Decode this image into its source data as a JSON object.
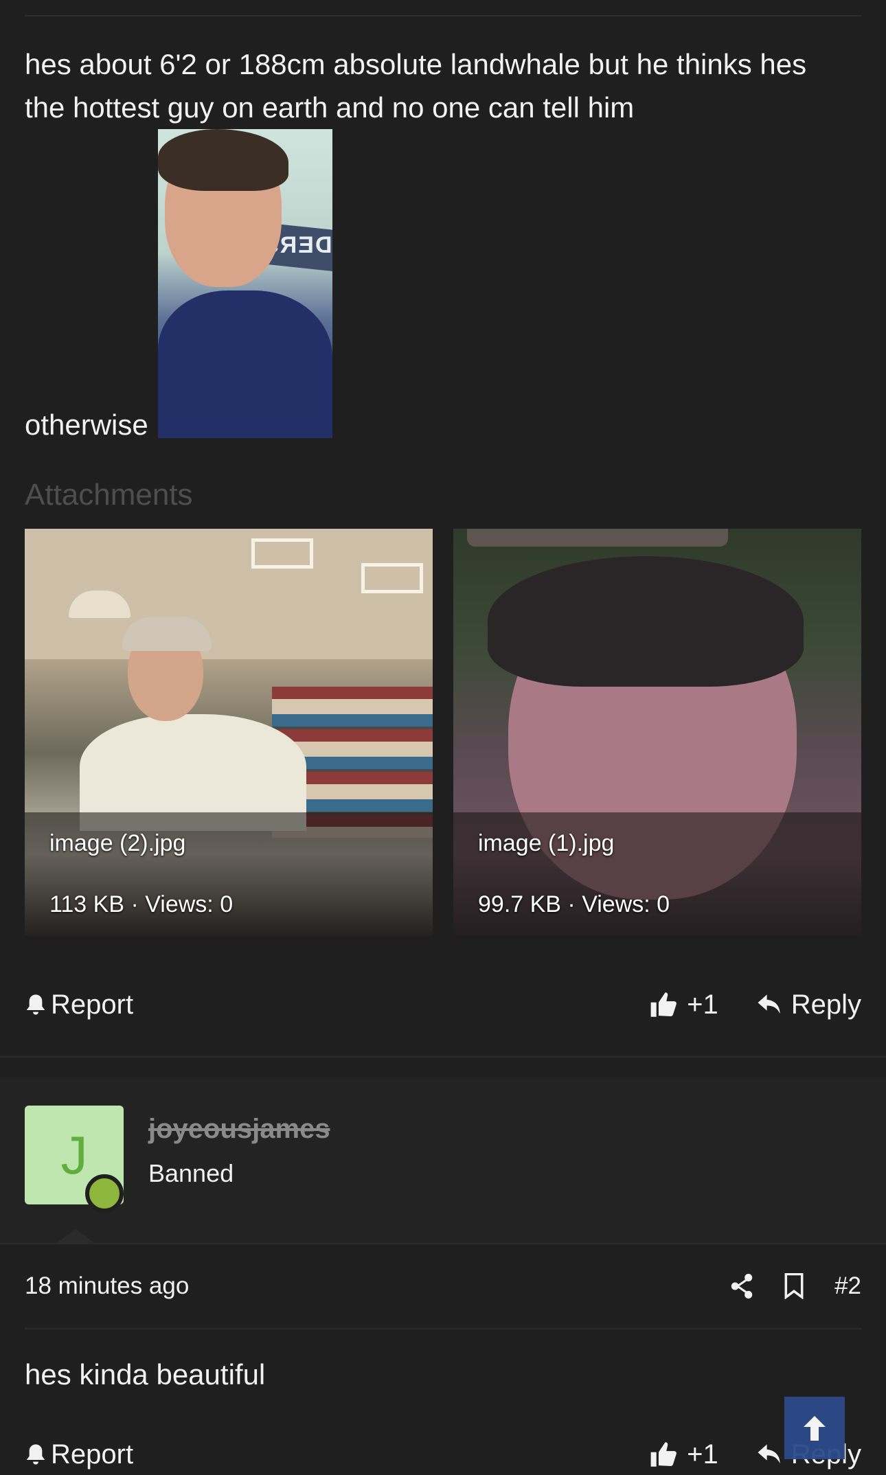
{
  "post1": {
    "body_text": "hes about 6'2 or 188cm absolute landwhale but he thinks hes the hottest guy on earth and no one can tell him",
    "inline_word": "otherwise",
    "inline_sign_text": "DERSHI",
    "attachments_heading": "Attachments",
    "attachments": [
      {
        "filename": "image (2).jpg",
        "meta": "113 KB · Views: 0"
      },
      {
        "filename": "image (1).jpg",
        "meta": "99.7 KB · Views: 0"
      }
    ],
    "actions": {
      "report": "Report",
      "like": "+1",
      "reply": "Reply"
    }
  },
  "post2": {
    "user": {
      "avatar_letter": "J",
      "username": "joyeousjames",
      "title": "Banned"
    },
    "timestamp": "18 minutes ago",
    "post_number": "#2",
    "body_text": "hes kinda beautiful",
    "actions": {
      "report": "Report",
      "like": "+1",
      "reply": "Reply"
    }
  },
  "icons": {
    "report": "bell-icon",
    "like": "thumbs-up-icon",
    "reply": "reply-arrow-icon",
    "share": "share-icon",
    "bookmark": "bookmark-icon",
    "scroll_top": "arrow-up-icon"
  },
  "colors": {
    "background": "#1f1f1f",
    "user_block": "#232323",
    "avatar_bg": "#bfe6ae",
    "avatar_letter": "#5fae3e",
    "online_dot": "#8cb63c",
    "scroll_top_button": "#2c4a8a",
    "muted_heading": "#4e4e4e"
  }
}
